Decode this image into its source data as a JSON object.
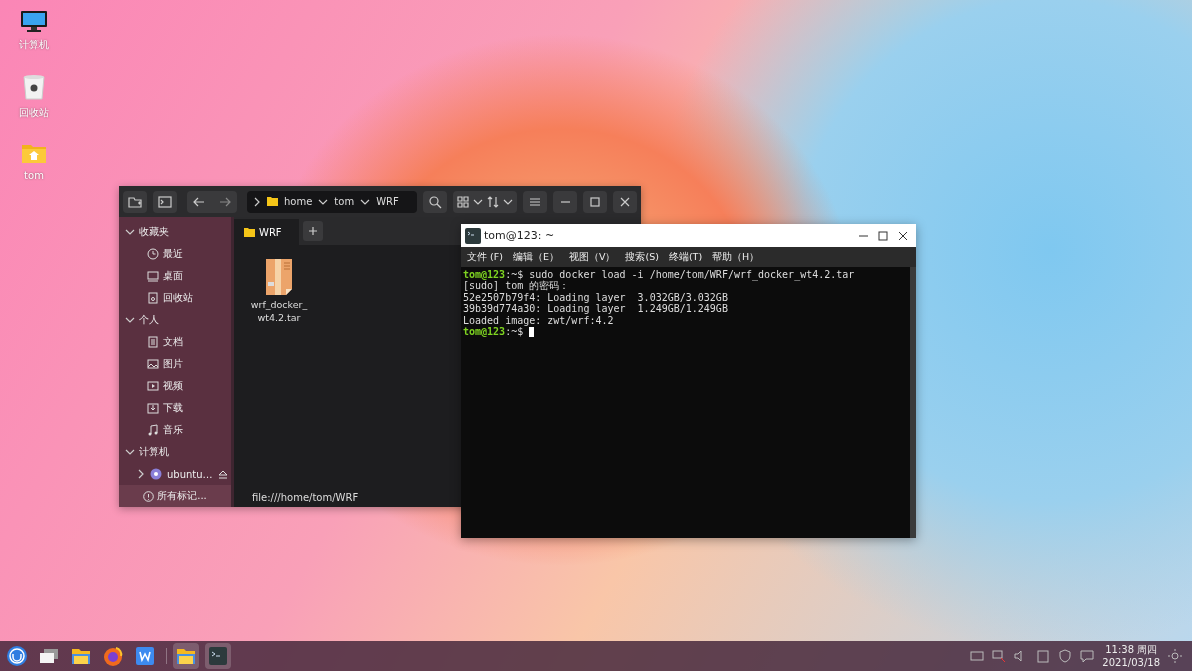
{
  "desktop_icons": [
    {
      "label": "计算机",
      "kind": "computer"
    },
    {
      "label": "回收站",
      "kind": "trash"
    },
    {
      "label": "tom",
      "kind": "home"
    }
  ],
  "file_manager": {
    "breadcrumb": [
      "home",
      "tom",
      "WRF"
    ],
    "sidebar": [
      {
        "label": "收藏夹",
        "expanded": true,
        "items": [
          {
            "label": "最近",
            "kind": "clock"
          },
          {
            "label": "桌面",
            "kind": "desktop"
          },
          {
            "label": "回收站",
            "kind": "trash"
          }
        ]
      },
      {
        "label": "个人",
        "expanded": true,
        "items": [
          {
            "label": "文档",
            "kind": "doc"
          },
          {
            "label": "图片",
            "kind": "image"
          },
          {
            "label": "视频",
            "kind": "video"
          },
          {
            "label": "下载",
            "kind": "download"
          },
          {
            "label": "音乐",
            "kind": "music"
          }
        ]
      },
      {
        "label": "计算机",
        "expanded": true,
        "items": [
          {
            "label": "ubuntu…",
            "kind": "drive"
          }
        ]
      }
    ],
    "marks_button": "所有标记...",
    "tabs": [
      {
        "label": "WRF",
        "selected": true
      }
    ],
    "files": [
      {
        "name": "wrf_docker_wt4.2.tar"
      }
    ],
    "location": "file:///home/tom/WRF"
  },
  "terminal": {
    "title": "tom@123: ~",
    "menus": [
      "文件 (F)",
      "编辑（E）",
      "视图（V）",
      "搜索(S)",
      "终端(T)",
      "帮助（H）"
    ],
    "lines": [
      [
        {
          "kind": "prompt",
          "text": "tom@123"
        },
        {
          "kind": "plain",
          "text": ":~$ sudo docker load -i /home/tom/WRF/wrf_docker_wt4.2.tar"
        }
      ],
      [
        {
          "kind": "plain",
          "text": "[sudo] tom 的密码："
        }
      ],
      [
        {
          "kind": "plain",
          "text": "52e2507b79f4: Loading layer  3.032GB/3.032GB"
        }
      ],
      [
        {
          "kind": "plain",
          "text": "39b39d774a30: Loading layer  1.249GB/1.249GB"
        }
      ],
      [
        {
          "kind": "plain",
          "text": "Loaded image: zwt/wrf:4.2"
        }
      ],
      [
        {
          "kind": "prompt",
          "text": "tom@123"
        },
        {
          "kind": "plain",
          "text": ":~$ "
        },
        {
          "kind": "cursor"
        }
      ]
    ]
  },
  "taskbar": {
    "apps": [
      {
        "kind": "start",
        "running": false
      },
      {
        "kind": "windows",
        "running": false
      },
      {
        "kind": "files",
        "running": false
      },
      {
        "kind": "browser",
        "running": false
      },
      {
        "kind": "writer",
        "running": false
      },
      {
        "kind": "files",
        "running": true
      },
      {
        "kind": "terminal",
        "running": true
      }
    ],
    "time": "11:38 周四",
    "date": "2021/03/18"
  }
}
